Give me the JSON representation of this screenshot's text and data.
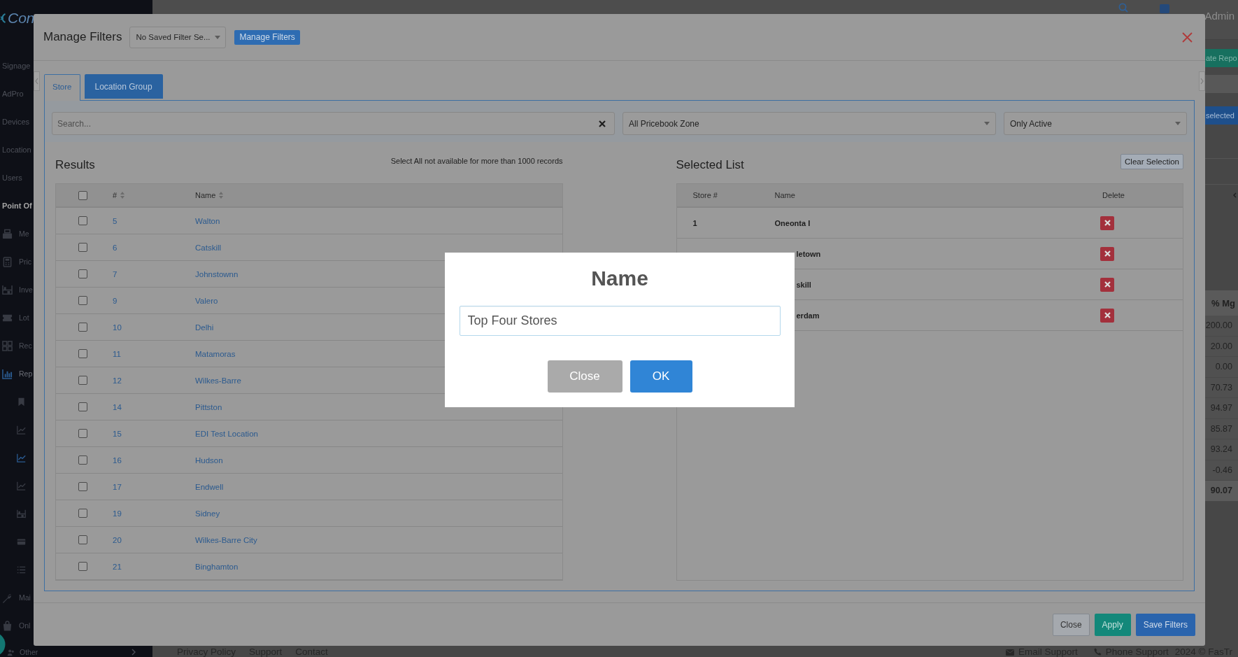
{
  "background_page": {
    "logo": {
      "text": "Con"
    },
    "sidebar": {
      "items": [
        {
          "kind": "link",
          "label": "Signage",
          "selected": false
        },
        {
          "kind": "link",
          "label": "AdPro",
          "selected": false
        },
        {
          "kind": "link",
          "label": "Devices",
          "selected": false
        },
        {
          "kind": "link",
          "label": "Location",
          "selected": false
        },
        {
          "kind": "link",
          "label": "Users",
          "selected": false
        },
        {
          "kind": "heading",
          "label": "Point Of",
          "selected": false
        },
        {
          "kind": "icon_link",
          "label": "Me",
          "selected": false
        },
        {
          "kind": "icon_link",
          "label": "Pric",
          "selected": false
        },
        {
          "kind": "icon_link",
          "label": "Inve",
          "selected": false
        },
        {
          "kind": "icon_link",
          "label": "Lot",
          "selected": false
        },
        {
          "kind": "icon_link",
          "label": "Rec",
          "selected": false
        },
        {
          "kind": "icon_link",
          "label": "Rep",
          "selected": true,
          "expanded": true,
          "children": [
            {
              "selected": false
            },
            {
              "selected": false
            },
            {
              "selected": true
            },
            {
              "selected": false
            },
            {
              "selected": false
            },
            {
              "selected": false
            },
            {
              "selected": false
            }
          ]
        },
        {
          "kind": "icon_link",
          "label": "Mai",
          "selected": false
        },
        {
          "kind": "icon_link",
          "label": "Onl",
          "selected": false
        },
        {
          "kind": "icon_link",
          "label": "Other",
          "selected": false,
          "expanded": false
        }
      ]
    },
    "header": {
      "user": "Admin"
    },
    "toolbar_buttons": [
      {
        "kind": "success",
        "label": "ate Repo"
      },
      {
        "kind": "primary",
        "label": "selected"
      }
    ],
    "report_table": {
      "column": "% Mg",
      "values": [
        "200.00",
        "20.00",
        "0.00",
        "70.73",
        "94.97",
        "85.87",
        "93.24",
        "-0.46"
      ],
      "total": "90.07"
    },
    "footer": {
      "links": [
        "Privacy Policy",
        "Support",
        "Contact"
      ],
      "contacts": [
        {
          "kind": "email",
          "label": "Email Support"
        },
        {
          "kind": "phone",
          "label": "Phone Support"
        }
      ],
      "copyright": "2024 © FasTr"
    }
  },
  "filters_dialog": {
    "title": "Manage Filters",
    "saved_filter_select": "No Saved Filter Se...",
    "manage_button": "Manage Filters",
    "tabs": [
      {
        "label": "Store",
        "selected": true
      },
      {
        "label": "Location Group",
        "selected": false
      }
    ],
    "search": {
      "placeholder": "Search..."
    },
    "zone_select": "All Pricebook Zone",
    "status_select": "Only Active",
    "results": {
      "title": "Results",
      "note": "Select All not available for more than 1000 records",
      "select_all_checked": false,
      "columns": [
        "#",
        "Name"
      ],
      "rows": [
        {
          "number": "5",
          "name": "Walton",
          "checked": false
        },
        {
          "number": "6",
          "name": "Catskill",
          "checked": false
        },
        {
          "number": "7",
          "name": "Johnstownn",
          "checked": false
        },
        {
          "number": "9",
          "name": "Valero",
          "checked": false
        },
        {
          "number": "10",
          "name": "Delhi",
          "checked": false
        },
        {
          "number": "11",
          "name": "Matamoras",
          "checked": false
        },
        {
          "number": "12",
          "name": "Wilkes-Barre",
          "checked": false
        },
        {
          "number": "14",
          "name": "Pittston",
          "checked": false
        },
        {
          "number": "15",
          "name": "EDI Test Location",
          "checked": false
        },
        {
          "number": "16",
          "name": "Hudson",
          "checked": false
        },
        {
          "number": "17",
          "name": "Endwell",
          "checked": false
        },
        {
          "number": "19",
          "name": "Sidney",
          "checked": false
        },
        {
          "number": "20",
          "name": "Wilkes-Barre City",
          "checked": false
        },
        {
          "number": "21",
          "name": "Binghamton",
          "checked": false
        }
      ]
    },
    "selected_list": {
      "title": "Selected List",
      "clear_button": "Clear Selection",
      "columns": [
        "Store #",
        "Name",
        "Delete"
      ],
      "rows": [
        {
          "store": "1",
          "name": "Oneonta I",
          "covered": false
        },
        {
          "name": "letown",
          "covered": true
        },
        {
          "name": "skill",
          "covered": true
        },
        {
          "name": "erdam",
          "covered": true
        }
      ]
    },
    "buttons": [
      {
        "kind": "default",
        "label": "Close"
      },
      {
        "kind": "success",
        "label": "Apply"
      },
      {
        "kind": "primary",
        "label": "Save Filters"
      }
    ]
  },
  "name_prompt": {
    "title": "Name",
    "value": "Top Four Stores",
    "buttons": [
      {
        "kind": "cancel",
        "label": "Close"
      },
      {
        "kind": "confirm",
        "label": "OK"
      }
    ]
  }
}
